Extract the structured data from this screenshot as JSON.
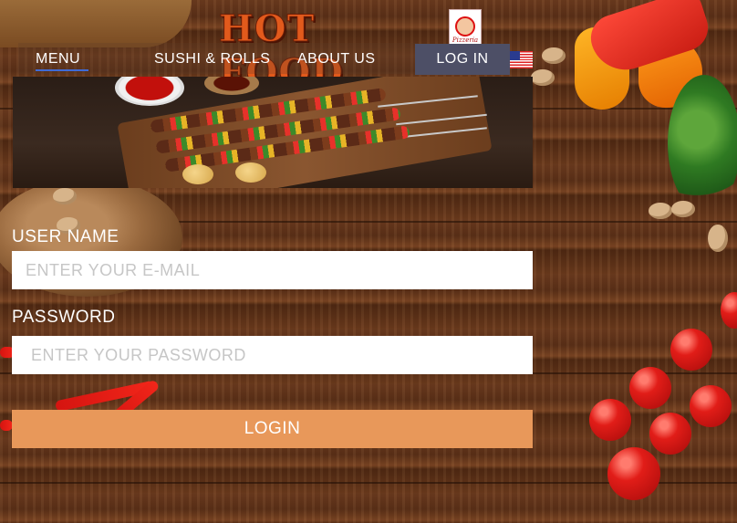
{
  "brand": {
    "logo_text": "HOT FOOD",
    "badge_text": "Pizzeria"
  },
  "nav": {
    "menu": "MENU",
    "sushi": "SUSHI & ROLLS",
    "about": "ABOUT US",
    "login": "LOG IN",
    "language_flag": "us-flag-icon"
  },
  "form": {
    "username_label": "USER NAME",
    "username_placeholder": "ENTER YOUR E-MAIL",
    "username_value": "",
    "password_label": "PASSWORD",
    "password_placeholder": "ENTER YOUR PASSWORD",
    "password_value": "",
    "submit_label": "LOGIN"
  },
  "colors": {
    "login_button": "#e8985a",
    "nav_login_bg": "#4d4f66",
    "menu_underline": "#3f6bd6",
    "logo": "#e25a1c"
  }
}
